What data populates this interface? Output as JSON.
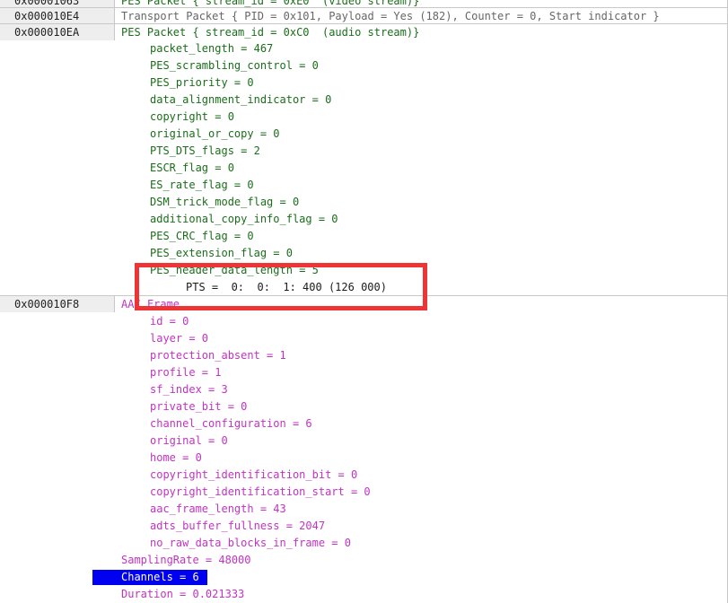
{
  "colors": {
    "offset_bg": "#eeeeee",
    "pes_text": "#1a6e1a",
    "aac_text": "#c233c2",
    "selection_bg": "#0000f0",
    "highlight_border": "#ee3535"
  },
  "rows": {
    "r0": {
      "offset": "0x00001063",
      "text": "PES Packet { stream_id = 0xE0  (video stream)}"
    },
    "r1": {
      "offset": "0x000010E4",
      "text": "Transport Packet { PID = 0x101, Payload = Yes (182), Counter = 0, Start indicator }"
    },
    "r2": {
      "offset": "0x000010EA",
      "text": "PES Packet { stream_id = 0xC0  (audio stream)}"
    }
  },
  "pes_fields": [
    "packet_length = 467",
    "PES_scrambling_control = 0",
    "PES_priority = 0",
    "data_alignment_indicator = 0",
    "copyright = 0",
    "original_or_copy = 0",
    "PTS_DTS_flags = 2",
    "ESCR_flag = 0",
    "ES_rate_flag = 0",
    "DSM_trick_mode_flag = 0",
    "additional_copy_info_flag = 0",
    "PES_CRC_flag = 0",
    "PES_extension_flag = 0",
    "PES_header_data_length = 5"
  ],
  "pts_line": "PTS =  0:  0:  1: 400 (126 000)",
  "aac_header": {
    "offset": "0x000010F8",
    "text": "AAC Frame"
  },
  "aac_fields": [
    "id = 0",
    "layer = 0",
    "protection_absent = 1",
    "profile = 1",
    "sf_index = 3",
    "private_bit = 0",
    "channel_configuration = 6",
    "original = 0",
    "home = 0",
    "copyright_identification_bit = 0",
    "copyright_identification_start = 0",
    "aac_frame_length = 43",
    "adts_buffer_fullness = 2047",
    "no_raw_data_blocks_in_frame = 0"
  ],
  "summary": {
    "sampling_rate": "SamplingRate = 48000",
    "channels": "Channels = 6",
    "duration": "Duration = 0.021333"
  }
}
